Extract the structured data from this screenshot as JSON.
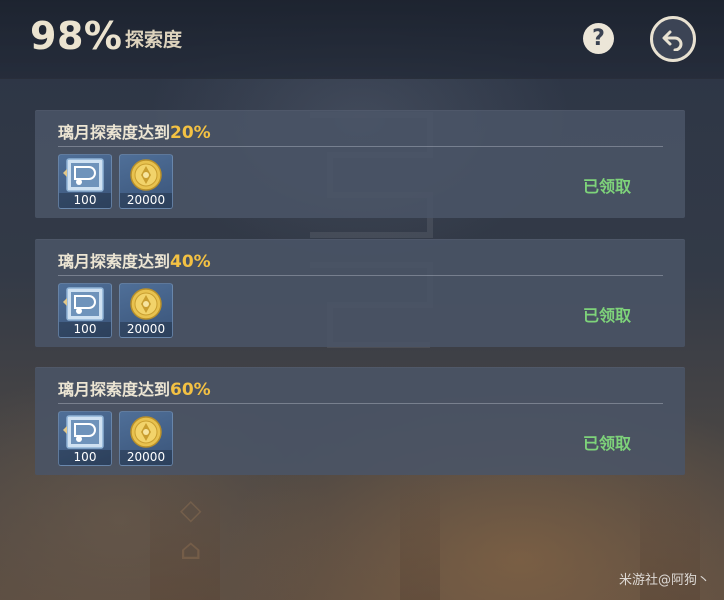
{
  "header": {
    "progress_value": "98%",
    "progress_label": "探索度",
    "help_icon": "question-mark-icon",
    "back_icon": "return-arrow-icon"
  },
  "rewards": [
    {
      "title_prefix": "璃月探索度达到",
      "title_percent": "20%",
      "items": [
        {
          "icon": "book-of-knowledge-icon",
          "qty": "100"
        },
        {
          "icon": "mora-coin-icon",
          "qty": "20000"
        }
      ],
      "status": "已领取"
    },
    {
      "title_prefix": "璃月探索度达到",
      "title_percent": "40%",
      "items": [
        {
          "icon": "book-of-knowledge-icon",
          "qty": "100"
        },
        {
          "icon": "mora-coin-icon",
          "qty": "20000"
        }
      ],
      "status": "已领取"
    },
    {
      "title_prefix": "璃月探索度达到",
      "title_percent": "60%",
      "items": [
        {
          "icon": "book-of-knowledge-icon",
          "qty": "100"
        },
        {
          "icon": "mora-coin-icon",
          "qty": "20000"
        }
      ],
      "status": "已领取"
    }
  ],
  "watermark": "米游社@阿狗丶",
  "colors": {
    "accent_percent": "#f3c143",
    "claimed_green": "#7ed37a",
    "card_bg": "#4a5466",
    "title_text": "#ece5d3"
  }
}
